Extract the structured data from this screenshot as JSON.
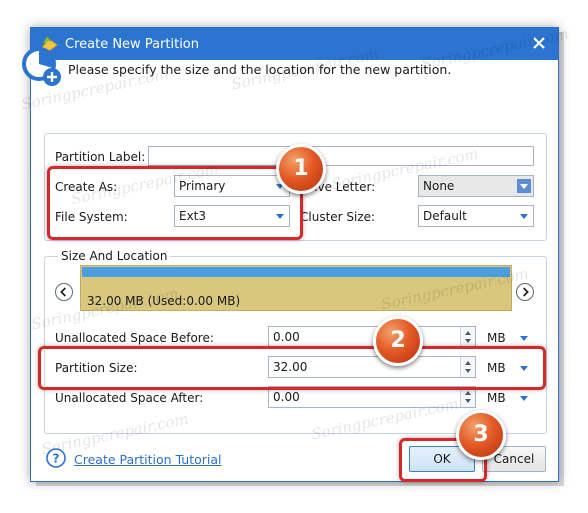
{
  "window": {
    "title": "Create New Partition",
    "header_text": "Please specify the size and the location for the new partition."
  },
  "fields": {
    "partition_label": {
      "label": "Partition Label:",
      "value": ""
    },
    "create_as": {
      "label": "Create As:",
      "value": "Primary"
    },
    "drive_letter": {
      "label": "Drive Letter:",
      "value": "None"
    },
    "file_system": {
      "label": "File System:",
      "value": "Ext3"
    },
    "cluster_size": {
      "label": "Cluster Size:",
      "value": "Default"
    }
  },
  "size_location": {
    "title": "Size And Location",
    "bar_text": "32.00 MB (Used:0.00 MB)",
    "unallocated_before": {
      "label": "Unallocated Space Before:",
      "value": "0.00",
      "unit": "MB"
    },
    "partition_size": {
      "label": "Partition Size:",
      "value": "32.00",
      "unit": "MB"
    },
    "unallocated_after": {
      "label": "Unallocated Space After:",
      "value": "0.00",
      "unit": "MB"
    }
  },
  "footer": {
    "tutorial_link": "Create Partition Tutorial",
    "ok_label": "OK",
    "cancel_label": "Cancel"
  },
  "annotations": {
    "badge1": "1",
    "badge2": "2",
    "badge3": "3"
  },
  "watermark": "Soringpcrepair.com",
  "colors": {
    "titlebar": "#2b74d0",
    "highlight": "#d6282a",
    "badge": "#e45a26",
    "partition_bar": "#d9c77d",
    "partition_bar_top": "#4a9de0",
    "link": "#2d6fc7"
  },
  "icons": [
    "app-icon",
    "close-icon",
    "partition-add-icon",
    "chevron-left-icon",
    "chevron-right-icon",
    "dropdown-arrow-icon",
    "spin-icon",
    "help-icon"
  ]
}
